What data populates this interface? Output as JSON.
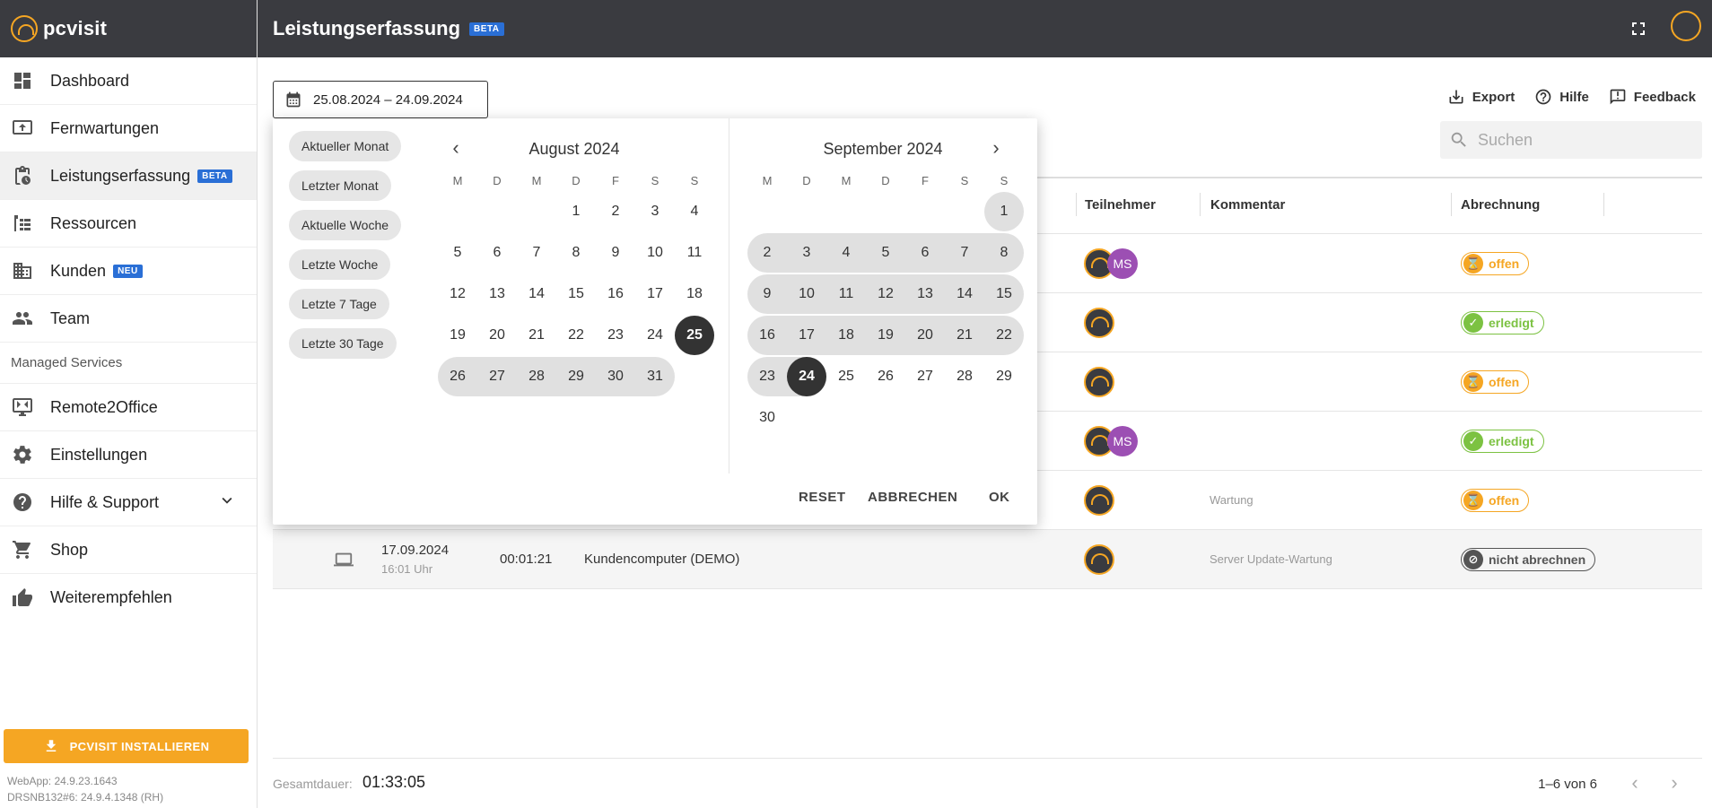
{
  "app": {
    "name": "pcvisit",
    "page_title": "Leistungserfassung",
    "beta_badge": "BETA"
  },
  "sidebar": {
    "items": [
      {
        "label": "Dashboard"
      },
      {
        "label": "Fernwartungen"
      },
      {
        "label": "Leistungserfassung",
        "badge": "BETA"
      },
      {
        "label": "Ressourcen"
      },
      {
        "label": "Kunden",
        "badge": "NEU"
      },
      {
        "label": "Team"
      }
    ],
    "section_label": "Managed Services",
    "items2": [
      {
        "label": "Remote2Office"
      },
      {
        "label": "Einstellungen"
      },
      {
        "label": "Hilfe & Support"
      },
      {
        "label": "Shop"
      },
      {
        "label": "Weiterempfehlen"
      }
    ],
    "install_label": "PCVISIT INSTALLIEREN",
    "version_webapp": "WebApp: 24.9.23.1643",
    "version_server": "DRSNB132#6: 24.9.4.1348 (RH)"
  },
  "toolbar": {
    "date_range": "25.08.2024 – 24.09.2024",
    "export": "Export",
    "help": "Hilfe",
    "feedback": "Feedback",
    "search_placeholder": "Suchen"
  },
  "table": {
    "headers": {
      "participants": "Teilnehmer",
      "comment": "Kommentar",
      "billing": "Abrechnung"
    },
    "rows": [
      {
        "participants": [
          "pcvisit",
          "MS"
        ],
        "comment": "",
        "status": "offen",
        "status_type": "offen"
      },
      {
        "participants": [
          "pcvisit"
        ],
        "comment": "",
        "status": "erledigt",
        "status_type": "erledigt"
      },
      {
        "participants": [
          "pcvisit"
        ],
        "comment": "",
        "status": "offen",
        "status_type": "offen"
      },
      {
        "participants": [
          "pcvisit",
          "MS"
        ],
        "comment": "",
        "status": "erledigt",
        "status_type": "erledigt"
      },
      {
        "participants": [
          "pcvisit"
        ],
        "comment": "Wartung",
        "status": "offen",
        "status_type": "offen"
      },
      {
        "date": "17.09.2024",
        "time": "16:01 Uhr",
        "duration": "00:01:21",
        "device": "Kundencomputer (DEMO)",
        "participants": [
          "pcvisit"
        ],
        "comment": "Server Update-Wartung",
        "status": "nicht abrechnen",
        "status_type": "nicht"
      }
    ]
  },
  "footer": {
    "total_label": "Gesamtdauer:",
    "total_value": "01:33:05",
    "pagination": "1–6 von 6"
  },
  "picker": {
    "presets": [
      "Aktueller Monat",
      "Letzter Monat",
      "Aktuelle Woche",
      "Letzte Woche",
      "Letzte 7 Tage",
      "Letzte 30 Tage"
    ],
    "weekdays": [
      "M",
      "D",
      "M",
      "D",
      "F",
      "S",
      "S"
    ],
    "month1": {
      "title": "August 2024",
      "offset": 3,
      "days": 31,
      "selected": 25,
      "range_start": 25
    },
    "month2": {
      "title": "September 2024",
      "offset": 6,
      "days": 30,
      "selected": 24,
      "range_end": 24
    },
    "reset": "RESET",
    "cancel": "ABBRECHEN",
    "ok": "OK"
  }
}
